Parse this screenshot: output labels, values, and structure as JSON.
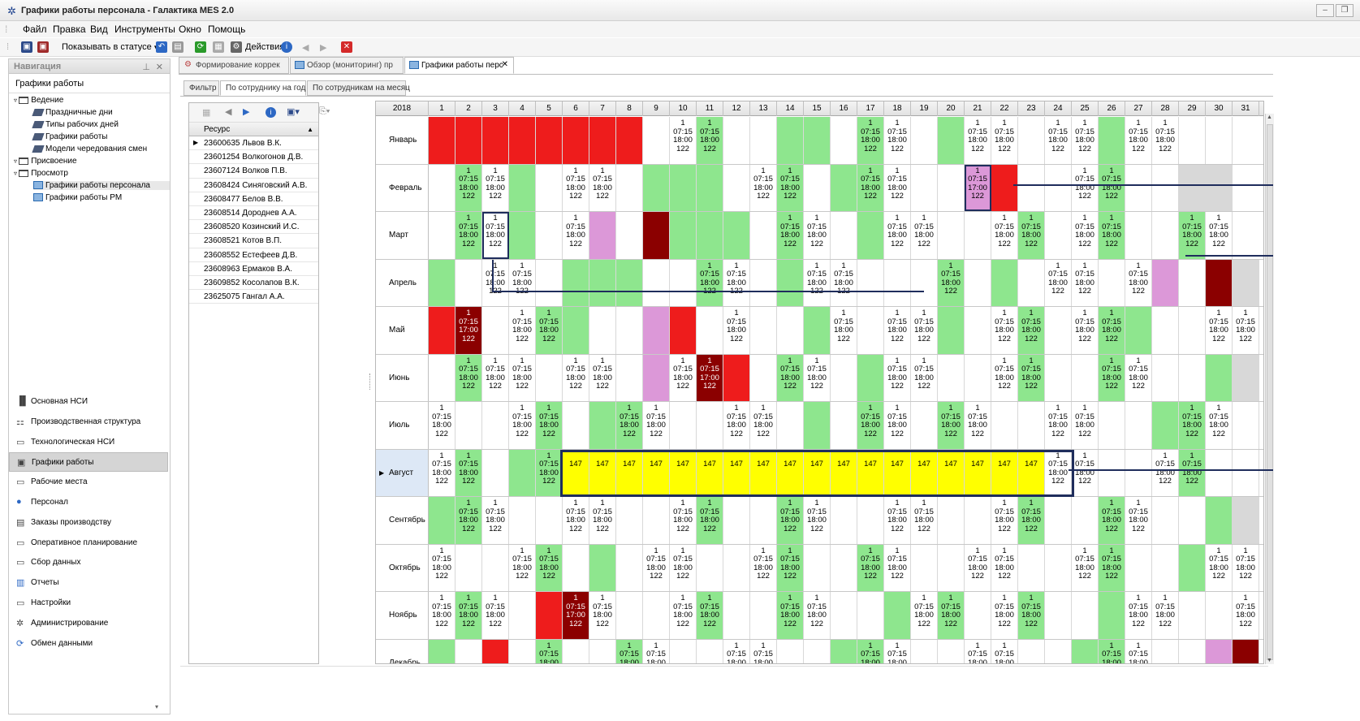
{
  "window": {
    "title": "Графики работы персонала - Галактика MES 2.0"
  },
  "menu": [
    "Файл",
    "Правка",
    "Вид",
    "Инструменты",
    "Окно",
    "Помощь"
  ],
  "toolbar": {
    "show_status": "Показывать в статусе",
    "actions": "Действия"
  },
  "nav": {
    "title": "Навигация",
    "subtitle": "Графики работы",
    "tree": [
      {
        "label": "Ведение",
        "level": 0,
        "kind": "folder"
      },
      {
        "label": "Праздничные дни",
        "level": 2,
        "kind": "book"
      },
      {
        "label": "Типы рабочих дней",
        "level": 2,
        "kind": "book"
      },
      {
        "label": "Графики работы",
        "level": 2,
        "kind": "book"
      },
      {
        "label": "Модели чередования смен",
        "level": 2,
        "kind": "book"
      },
      {
        "label": "Присвоение",
        "level": 0,
        "kind": "folder"
      },
      {
        "label": "Просмотр",
        "level": 0,
        "kind": "folder"
      },
      {
        "label": "Графики работы персонала",
        "level": 2,
        "kind": "grid"
      },
      {
        "label": "Графики работы РМ",
        "level": 2,
        "kind": "grid"
      }
    ],
    "sections": [
      "Основная НСИ",
      "Производственная структура",
      "Технологическая НСИ",
      "Графики работы",
      "Рабочие места",
      "Персонал",
      "Заказы производству",
      "Оперативное планирование",
      "Сбор данных",
      "Отчеты",
      "Настройки",
      "Администрирование",
      "Обмен данными"
    ],
    "active_section": "Графики работы"
  },
  "tabs": [
    "Формирование коррек",
    "Обзор (мониторинг) пр",
    "Графики работы перс"
  ],
  "active_tab": "Графики работы перс",
  "subtabs": [
    "Фильтр",
    "По сотруднику на год",
    "По сотрудникам на месяц"
  ],
  "active_subtab": "По сотруднику на год",
  "resources": {
    "header": "Ресурс",
    "items": [
      "23600635 Львов В.К.",
      "23601254 Волкогонов Д.В.",
      "23607124 Волков П.В.",
      "23608424 Синяговский А.В.",
      "23608477 Белов В.В.",
      "23608514 Дороднев А.А.",
      "23608520 Козинский И.С.",
      "23608521 Котов В.П.",
      "23608552 Естефеев Д.В.",
      "23608963 Ермаков В.А.",
      "23609852 Косолапов В.К.",
      "23625075 Гангал А.А."
    ]
  },
  "calendar": {
    "year": "2018",
    "shift_text": "1\n07:15\n18:00\n122",
    "shift_text_alt": "1\n07:15\n17:00\n122",
    "yellow_text": "147",
    "months": [
      {
        "name": "Январь",
        "cells": "rrrrrrrr.SS..gg.SS.gSS.SSgSS.."
      },
      {
        "name": "Февраль",
        "cells": ".SSg.SS.ggg.SS.gSS..Pr..SS..xx"
      },
      {
        "name": "Март",
        "cells": ".SSg.SpRDggg.SS.gSS..SS.SS..SS"
      },
      {
        "name": "Апрель",
        "cells": "g.SS.ggg..SS.gSS...S.g.SS.Sp.Dx"
      },
      {
        "name": "Май",
        "cells": "rD.SSg..pr.S..gS.SSg.SS.SSg..SS"
      },
      {
        "name": "Июнь",
        "cells": ".SSS.SS.pSDr.SS.gSS..SS..SS..gx"
      },
      {
        "name": "Июль",
        "cells": "S..SS.gSS..SS.g.SS.SS..SS..gSS."
      },
      {
        "name": "Август",
        "cells": "SS.gSYYYYYYYYYYYYYYYYYYSS..SS.."
      },
      {
        "name": "Сентябрь",
        "cells": "gSS..SS..SS..SS..SS..SS..SS..gx"
      },
      {
        "name": "Октябрь",
        "cells": "S..SS.g.SS..SS..SS..SS..SS..gSS"
      },
      {
        "name": "Ноябрь",
        "cells": "SSS.rDS..SS..SS..gSS.SS..gSS..SS"
      },
      {
        "name": "Декабрь",
        "cells": "g.r.S..SS..SS..gSS..SS..gSS..pD"
      }
    ]
  },
  "colors": {
    "green": "#8ee68e",
    "red": "#ee1c1c",
    "dark_red": "#8b0000",
    "pink": "#dc98d8",
    "yellow": "#ffff00",
    "gray": "#d8d8d8",
    "selection": "#1f2d5c"
  }
}
